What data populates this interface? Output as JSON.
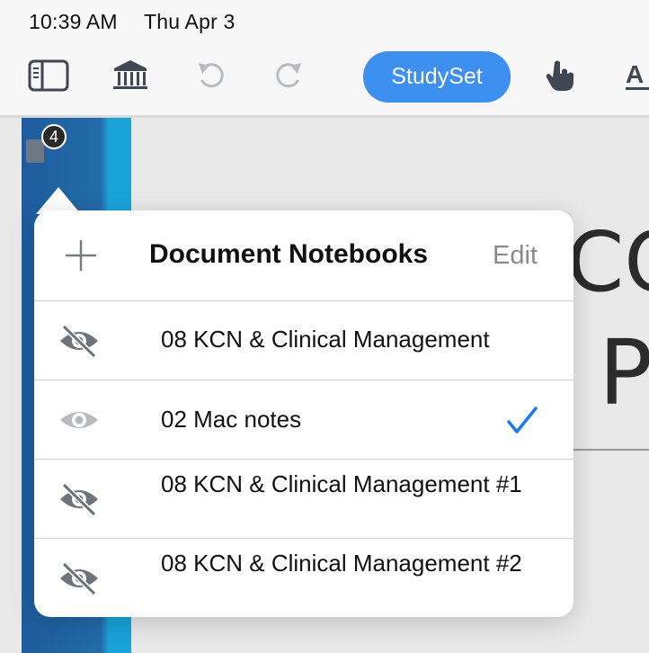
{
  "status_bar": {
    "time": "10:39 AM",
    "date": "Thu Apr 3"
  },
  "toolbar": {
    "studyset_label": "StudySet",
    "icons": [
      "sidebar-toggle-icon",
      "library-icon",
      "undo-icon",
      "redo-icon",
      "hand-pointer-icon",
      "text-format-icon"
    ]
  },
  "sidebar": {
    "badge_count": "4"
  },
  "page_background": {
    "heading_fragment_1": "CO",
    "heading_fragment_2": "P"
  },
  "popover": {
    "title": "Document Notebooks",
    "edit_label": "Edit",
    "notebooks": [
      {
        "label": "08 KCN & Clinical Management",
        "visible": false,
        "selected": false
      },
      {
        "label": "02 Mac notes",
        "visible": true,
        "selected": true
      },
      {
        "label": "08 KCN & Clinical Management #1",
        "visible": false,
        "selected": false
      },
      {
        "label": "08 KCN & Clinical Management #2",
        "visible": false,
        "selected": false
      }
    ]
  },
  "colors": {
    "accent": "#3d8ff0",
    "checkmark": "#1a7af2",
    "sidebar": "#226ba9",
    "icon_gray": "#7b7f85",
    "icon_light": "#b7babe"
  }
}
